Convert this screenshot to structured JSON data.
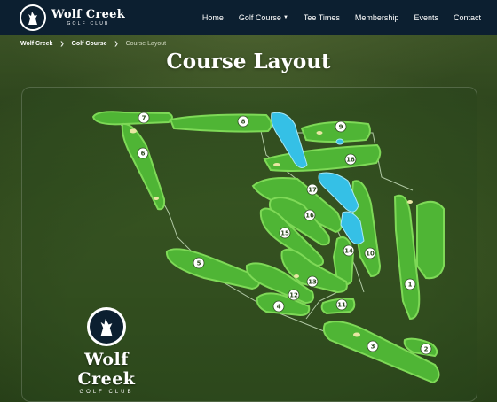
{
  "brand": {
    "name": "Wolf Creek",
    "sub": "GOLF CLUB",
    "logo_icon": "wolf-howling-icon"
  },
  "nav": {
    "items": [
      {
        "label": "Home"
      },
      {
        "label": "Golf Course",
        "has_dropdown": true
      },
      {
        "label": "Tee Times"
      },
      {
        "label": "Membership"
      },
      {
        "label": "Events"
      },
      {
        "label": "Contact"
      }
    ]
  },
  "breadcrumb": {
    "items": [
      "Wolf Creek",
      "Golf Course",
      "Course Layout"
    ],
    "separator_icon": "chevron-right-icon"
  },
  "page": {
    "title": "Course Layout"
  },
  "course_map": {
    "hole_labels": [
      "1",
      "2",
      "3",
      "4",
      "5",
      "6",
      "7",
      "8",
      "9",
      "10",
      "11",
      "12",
      "13",
      "14",
      "15",
      "16",
      "17",
      "18"
    ]
  },
  "colors": {
    "header_bg": "#0c1f30",
    "fairway": "#4fb535",
    "rough": "#7ed957",
    "water": "#35c0e6",
    "bunker": "#e8e6a3"
  }
}
